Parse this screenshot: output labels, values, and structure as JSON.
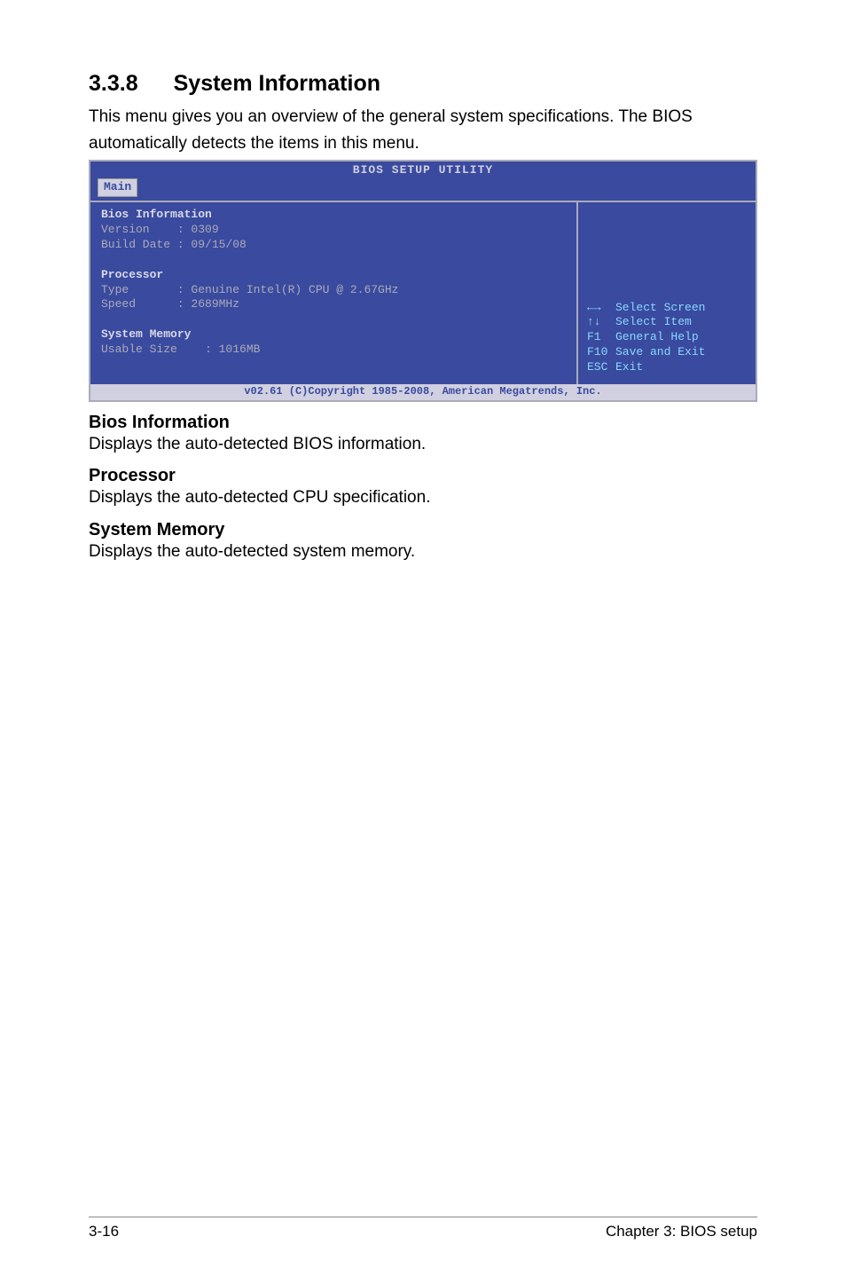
{
  "section": {
    "number": "3.3.8",
    "title": "System Information",
    "intro1": "This menu gives you an overview of the general system specifications. The BIOS",
    "intro2": "automatically detects the items in this menu."
  },
  "bios": {
    "title": "BIOS SETUP UTILITY",
    "tab": "Main",
    "left": {
      "h1": "Bios Information",
      "l1": "Version    : 0309",
      "l2": "Build Date : 09/15/08",
      "h2": "Processor",
      "l3": "Type       : Genuine Intel(R) CPU @ 2.67GHz",
      "l4": "Speed      : 2689MHz",
      "h3": "System Memory",
      "l5": "Usable Size    : 1016MB"
    },
    "right": {
      "k1": "←→",
      "v1": "Select Screen",
      "k2": "↑↓",
      "v2": "Select Item",
      "k3": "F1",
      "v3": "General Help",
      "k4": "F10",
      "v4": "Save and Exit",
      "k5": "ESC",
      "v5": "Exit"
    },
    "footer": "v02.61 (C)Copyright 1985-2008, American Megatrends, Inc."
  },
  "subsections": {
    "h1": "Bios Information",
    "p1": "Displays the auto-detected BIOS information.",
    "h2": "Processor",
    "p2": "Displays the auto-detected CPU specification.",
    "h3": "System Memory",
    "p3": "Displays the auto-detected system memory."
  },
  "footer": {
    "left": "3-16",
    "right": "Chapter 3: BIOS setup"
  }
}
